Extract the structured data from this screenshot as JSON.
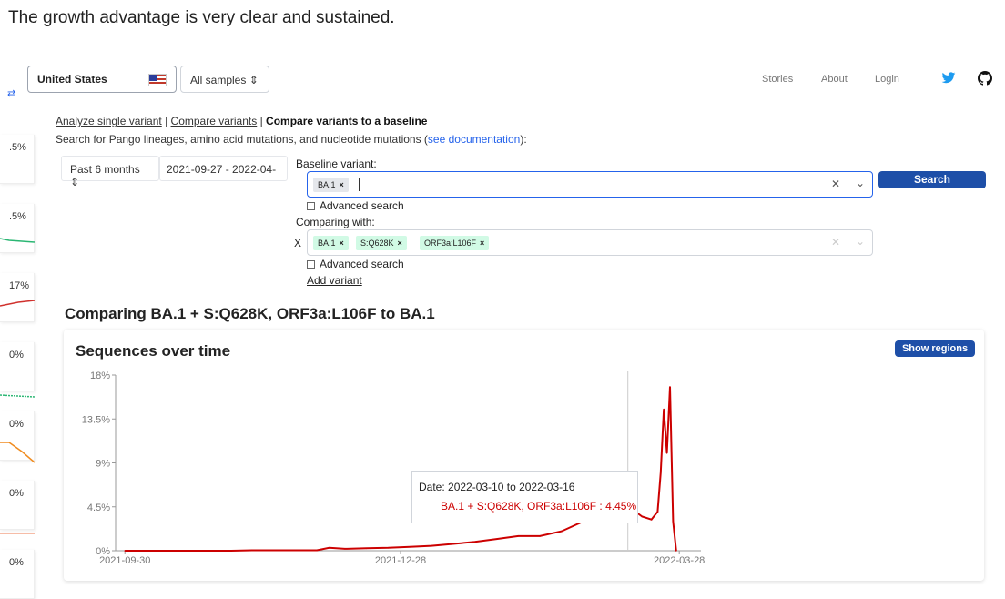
{
  "intro_text": "The growth advantage is very clear and sustained.",
  "header": {
    "country": "United States",
    "samples": "All samples",
    "nav": [
      "Stories",
      "About",
      "Login"
    ]
  },
  "sidebar": {
    "cards": [
      {
        "pct": ".5%",
        "color": "#f0a040"
      },
      {
        "pct": ".5%",
        "color": "#2bb673"
      },
      {
        "pct": "17%",
        "color": "#d0312d"
      },
      {
        "pct": "0%",
        "color": "#2bb673"
      },
      {
        "pct": "0%",
        "color": "#f08c20"
      },
      {
        "pct": "0%",
        "color": "#f4a58a"
      },
      {
        "pct": "0%",
        "color": "#cccccc"
      }
    ]
  },
  "tabs": {
    "single": "Analyze single variant",
    "sep1": " | ",
    "compare": "Compare variants",
    "sep2": " | ",
    "baseline": "Compare variants to a baseline"
  },
  "search_desc": {
    "text": "Search for Pango lineages, amino acid mutations, and nucleotide mutations (",
    "link": "see documentation",
    "end": "):"
  },
  "filters": {
    "period": "Past 6 months",
    "daterange": "2021-09-27 - 2022-04-"
  },
  "baseline": {
    "label": "Baseline variant:",
    "chips": [
      "BA.1"
    ],
    "advanced": "Advanced search"
  },
  "comparing": {
    "label": "Comparing with:",
    "prefix": "X",
    "chips": [
      "BA.1",
      "S:Q628K",
      "ORF3a:L106F"
    ],
    "advanced": "Advanced search",
    "add": "Add variant"
  },
  "search_button": "Search",
  "compare_title": "Comparing BA.1 + S:Q628K, ORF3a:L106F to BA.1",
  "chart": {
    "title": "Sequences over time",
    "show_regions": "Show regions",
    "tooltip": {
      "date": "Date: 2022-03-10 to 2022-03-16",
      "value": "BA.1 + S:Q628K, ORF3a:L106F : 4.45%"
    }
  },
  "chart_data": {
    "type": "line",
    "title": "Sequences over time",
    "xlabel": "",
    "ylabel": "",
    "x_ticks": [
      "2021-09-30",
      "2021-12-28",
      "2022-03-28"
    ],
    "y_ticks": [
      "0%",
      "4.5%",
      "9%",
      "13.5%",
      "18%"
    ],
    "ylim": [
      0,
      18
    ],
    "xlim": [
      "2021-09-27",
      "2022-04-04"
    ],
    "series": [
      {
        "name": "BA.1 + S:Q628K, ORF3a:L106F",
        "color": "#cc0000",
        "x": [
          "2021-09-30",
          "2021-10-06",
          "2021-10-10",
          "2021-10-20",
          "2021-10-27",
          "2021-11-03",
          "2021-11-10",
          "2021-11-17",
          "2021-11-24",
          "2021-12-01",
          "2021-12-05",
          "2021-12-10",
          "2021-12-17",
          "2021-12-24",
          "2021-12-31",
          "2022-01-07",
          "2022-01-14",
          "2022-01-21",
          "2022-01-28",
          "2022-02-04",
          "2022-02-11",
          "2022-02-18",
          "2022-02-25",
          "2022-03-01",
          "2022-03-04",
          "2022-03-07",
          "2022-03-10",
          "2022-03-13",
          "2022-03-16",
          "2022-03-19",
          "2022-03-21",
          "2022-03-22",
          "2022-03-23",
          "2022-03-24",
          "2022-03-25",
          "2022-03-26",
          "2022-03-27"
        ],
        "y": [
          0,
          0,
          0,
          0,
          0,
          0,
          0.05,
          0.05,
          0.05,
          0.05,
          0.3,
          0.2,
          0.25,
          0.3,
          0.4,
          0.5,
          0.7,
          0.9,
          1.2,
          1.5,
          1.5,
          2.0,
          3.0,
          3.5,
          3.0,
          4.0,
          4.45,
          4.2,
          3.5,
          3.2,
          4.0,
          8.0,
          14.5,
          10.0,
          16.8,
          3.0,
          0
        ]
      }
    ]
  }
}
